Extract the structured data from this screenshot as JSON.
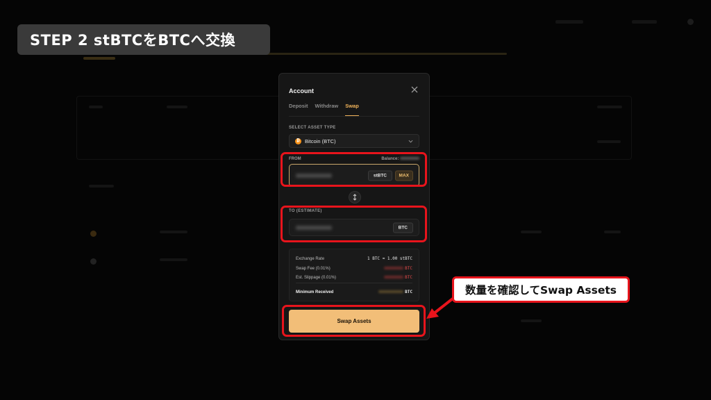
{
  "banner": {
    "text": "STEP 2 stBTCをBTCへ交換"
  },
  "modal": {
    "title": "Account",
    "tabs": [
      {
        "label": "Deposit",
        "active": false
      },
      {
        "label": "Withdraw",
        "active": false
      },
      {
        "label": "Swap",
        "active": true
      }
    ],
    "asset_type_label": "SELECT ASSET TYPE",
    "asset_selected": "Bitcoin (BTC)",
    "from": {
      "label": "FROM",
      "balance_label": "Balance:",
      "unit": "stBTC",
      "max_label": "MAX"
    },
    "to": {
      "label": "TO (ESTIMATE)",
      "unit": "BTC"
    },
    "summary": {
      "exchange_rate_label": "Exchange Rate",
      "exchange_rate_value": "1 BTC ≈ 1.00 stBTC",
      "swap_fee_label": "Swap Fee (0.01%)",
      "swap_fee_unit": "BTC",
      "slippage_label": "Est. Slippage (0.01%)",
      "slippage_unit": "BTC",
      "min_received_label": "Minimum Received",
      "min_received_unit": "BTC"
    },
    "swap_button": "Swap Assets"
  },
  "callout": {
    "text": "数量を確認してSwap Assets"
  },
  "colors": {
    "accent": "#f0b35a",
    "highlight": "#e8141c",
    "button": "#f2be78",
    "bitcoin": "#f7931a"
  }
}
